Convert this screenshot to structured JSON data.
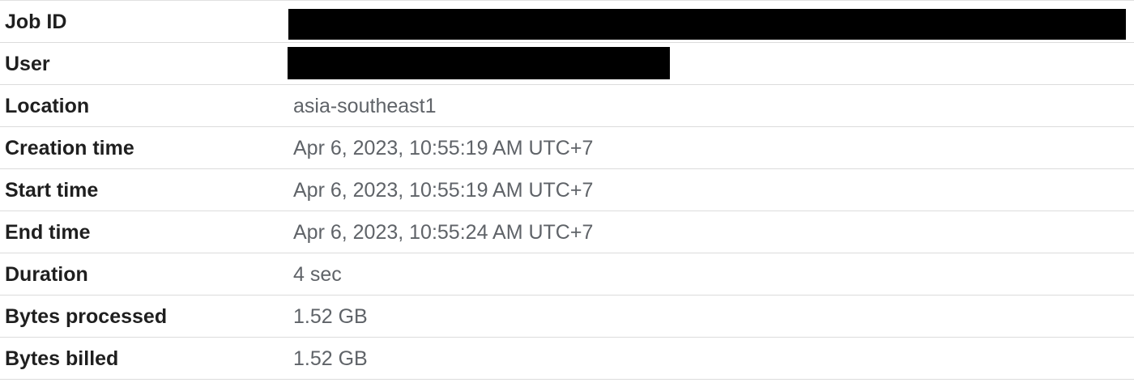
{
  "job_details": {
    "colors": {
      "label": "#1f1f1f",
      "value": "#5f6368",
      "divider": "#dcdcdc",
      "redaction": "#000000"
    },
    "rows": [
      {
        "label": "Job ID",
        "value": "",
        "redacted": true
      },
      {
        "label": "User",
        "value": "",
        "redacted": true
      },
      {
        "label": "Location",
        "value": "asia-southeast1"
      },
      {
        "label": "Creation time",
        "value": "Apr 6, 2023, 10:55:19 AM UTC+7"
      },
      {
        "label": "Start time",
        "value": "Apr 6, 2023, 10:55:19 AM UTC+7"
      },
      {
        "label": "End time",
        "value": "Apr 6, 2023, 10:55:24 AM UTC+7"
      },
      {
        "label": "Duration",
        "value": "4 sec"
      },
      {
        "label": "Bytes processed",
        "value": "1.52 GB"
      },
      {
        "label": "Bytes billed",
        "value": "1.52 GB"
      }
    ]
  }
}
